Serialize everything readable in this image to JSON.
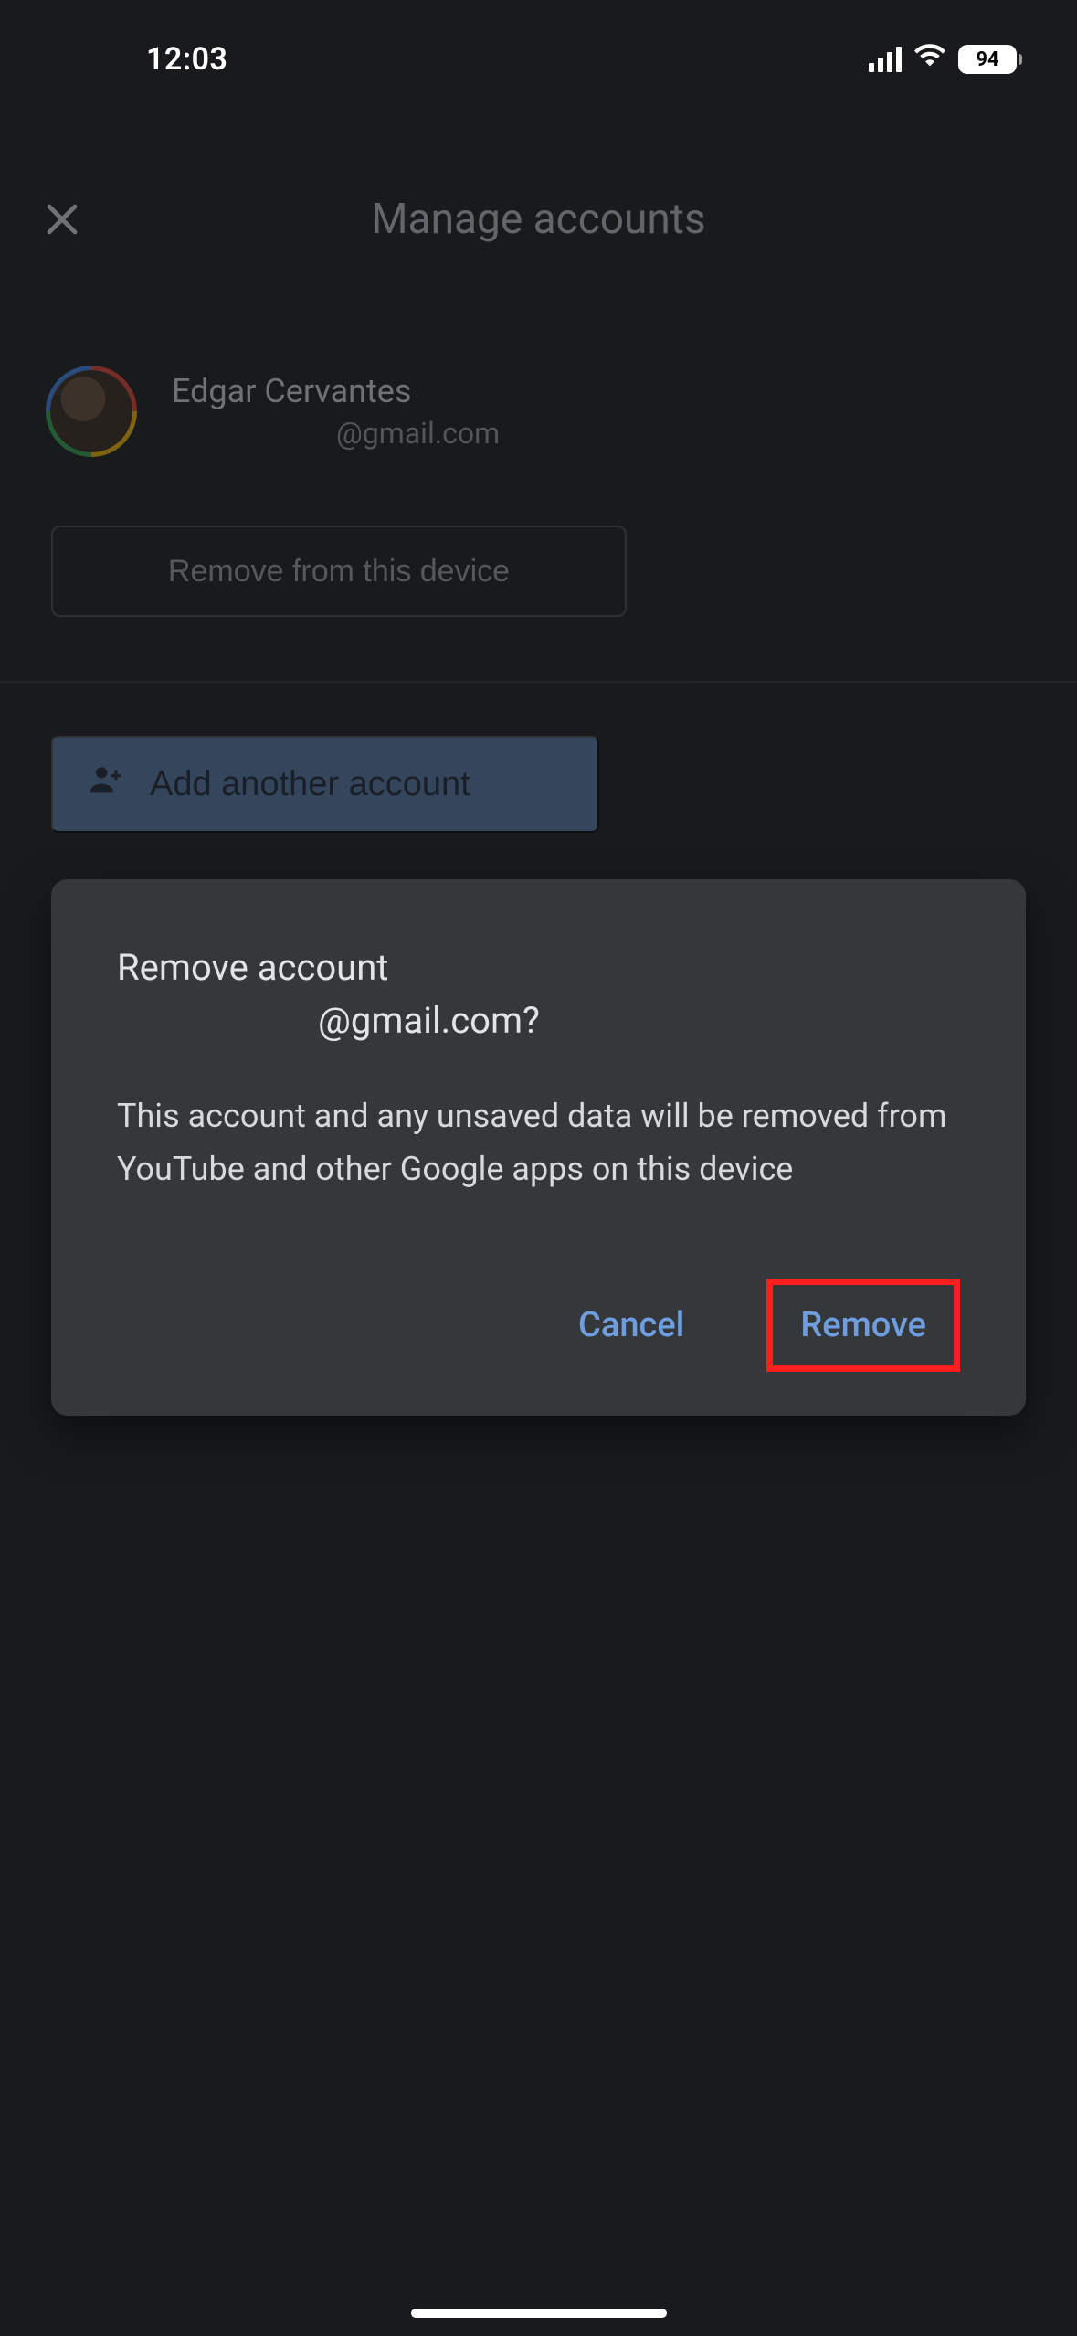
{
  "status": {
    "time": "12:03",
    "battery": "94"
  },
  "header": {
    "title": "Manage accounts"
  },
  "account": {
    "name": "Edgar Cervantes",
    "email": "@gmail.com",
    "remove_device_label": "Remove from this device"
  },
  "add_account_label": "Add another account",
  "dialog": {
    "title_line1": "Remove account",
    "title_line2": "@gmail.com?",
    "body": "This account and any unsaved data will be removed from YouTube and other Google apps on this device",
    "cancel_label": "Cancel",
    "remove_label": "Remove"
  }
}
